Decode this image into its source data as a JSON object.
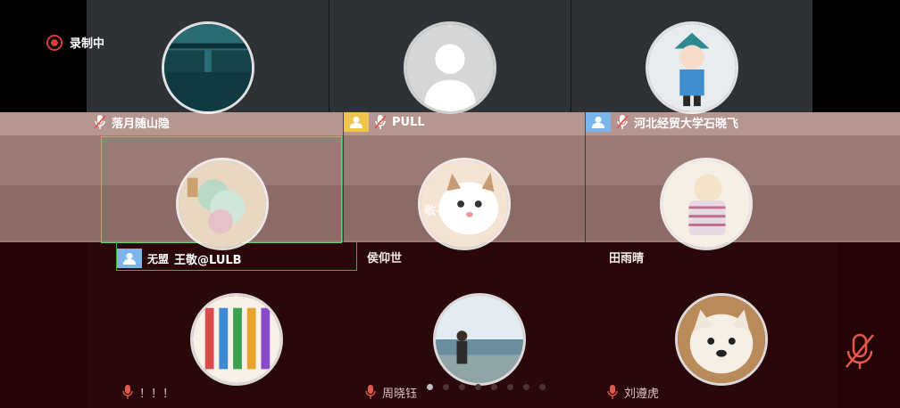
{
  "recording": {
    "label": "录制中"
  },
  "participants_top": [
    {
      "name": "落月随山隐",
      "avatar": "lake-night-photo"
    },
    {
      "name": "PULL",
      "avatar": "default-person-silhouette"
    },
    {
      "name": "河北经贸大学石晓飞",
      "avatar": "opera-cartoon-character"
    }
  ],
  "participants_middle": [
    {
      "name": "王敬@LULB",
      "avatar": "jade-ornament-photo",
      "overlay_text": "无盟"
    },
    {
      "name": "侯仰世",
      "avatar": "cat-photo",
      "avatar_text": "敬礼"
    },
    {
      "name": "田雨晴",
      "avatar": "plush-toy-photo"
    }
  ],
  "participants_bottom": [
    {
      "name": "！！！",
      "avatar": "colorful-text-art"
    },
    {
      "name": "周晓钰",
      "avatar": "person-by-lake-photo"
    },
    {
      "name": "刘遵虎",
      "avatar": "white-dog-photo"
    }
  ],
  "pager": {
    "pages": 8,
    "current": 0
  },
  "colors": {
    "record_red": "#d93a3a",
    "mic_red": "#e2584a",
    "active_green": "#6fd36f"
  }
}
